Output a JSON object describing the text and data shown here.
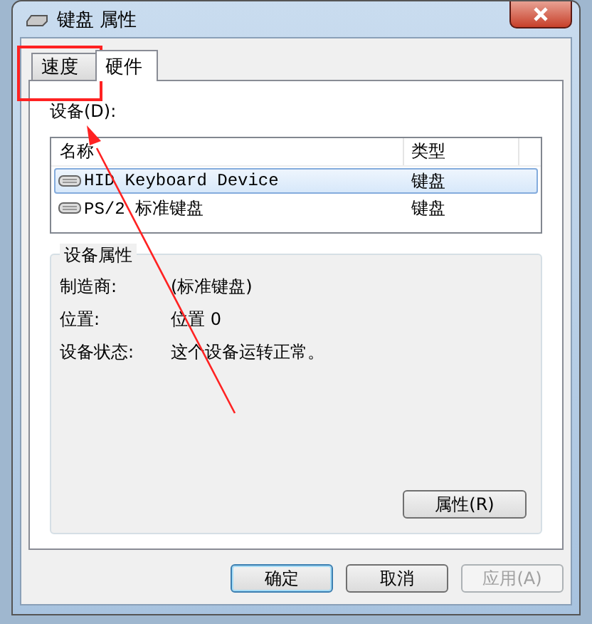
{
  "window": {
    "title": "键盘 属性"
  },
  "tabs": [
    {
      "label": "速度",
      "selected": false
    },
    {
      "label": "硬件",
      "selected": true
    }
  ],
  "devices": {
    "label": "设备(D):",
    "columns": [
      "名称",
      "类型"
    ],
    "rows": [
      {
        "name": "HID Keyboard Device",
        "type": "键盘",
        "selected": true
      },
      {
        "name": "PS/2 标准键盘",
        "type": "键盘",
        "selected": false
      }
    ]
  },
  "device_properties": {
    "title": "设备属性",
    "fields": [
      {
        "label": "制造商:",
        "value": "(标准键盘)"
      },
      {
        "label": "位置:",
        "value": "位置 0"
      },
      {
        "label": "设备状态:",
        "value": "这个设备运转正常。"
      }
    ],
    "button": "属性(R)"
  },
  "buttons": [
    {
      "label": "确定",
      "default": true,
      "disabled": false
    },
    {
      "label": "取消",
      "default": false,
      "disabled": false
    },
    {
      "label": "应用(A)",
      "default": false,
      "disabled": true
    }
  ]
}
